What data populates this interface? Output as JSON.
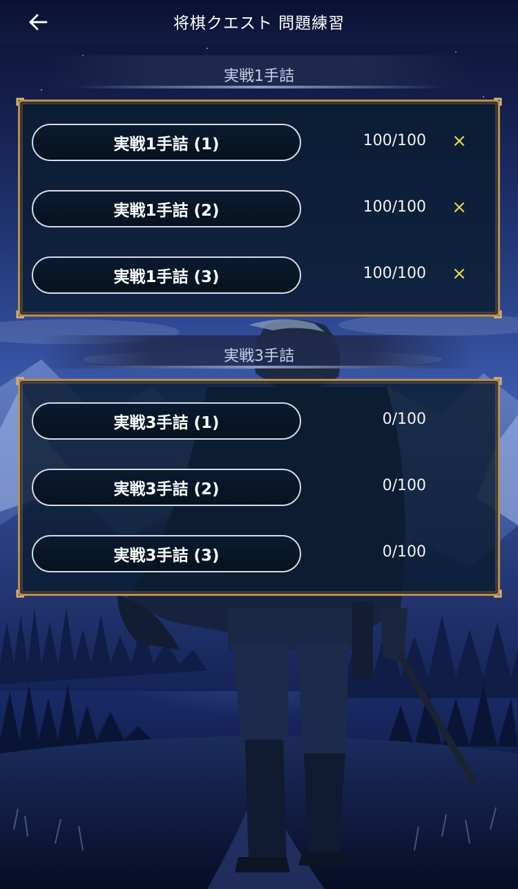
{
  "header": {
    "title": "将棋クエスト 問題練習",
    "back_icon": "arrow-left-icon"
  },
  "sections": [
    {
      "title": "実戦1手詰",
      "items": [
        {
          "label": "実戦1手詰 (1)",
          "score": "100/100",
          "mark": "×"
        },
        {
          "label": "実戦1手詰 (2)",
          "score": "100/100",
          "mark": "×"
        },
        {
          "label": "実戦1手詰 (3)",
          "score": "100/100",
          "mark": "×"
        }
      ]
    },
    {
      "title": "実戦3手詰",
      "items": [
        {
          "label": "実戦3手詰 (1)",
          "score": "0/100",
          "mark": ""
        },
        {
          "label": "実戦3手詰 (2)",
          "score": "0/100",
          "mark": ""
        },
        {
          "label": "実戦3手詰 (3)",
          "score": "0/100",
          "mark": ""
        }
      ]
    }
  ],
  "colors": {
    "panel_border": "#b88f52",
    "mark": "#e8d94a",
    "button_border": "#d8dde6"
  }
}
